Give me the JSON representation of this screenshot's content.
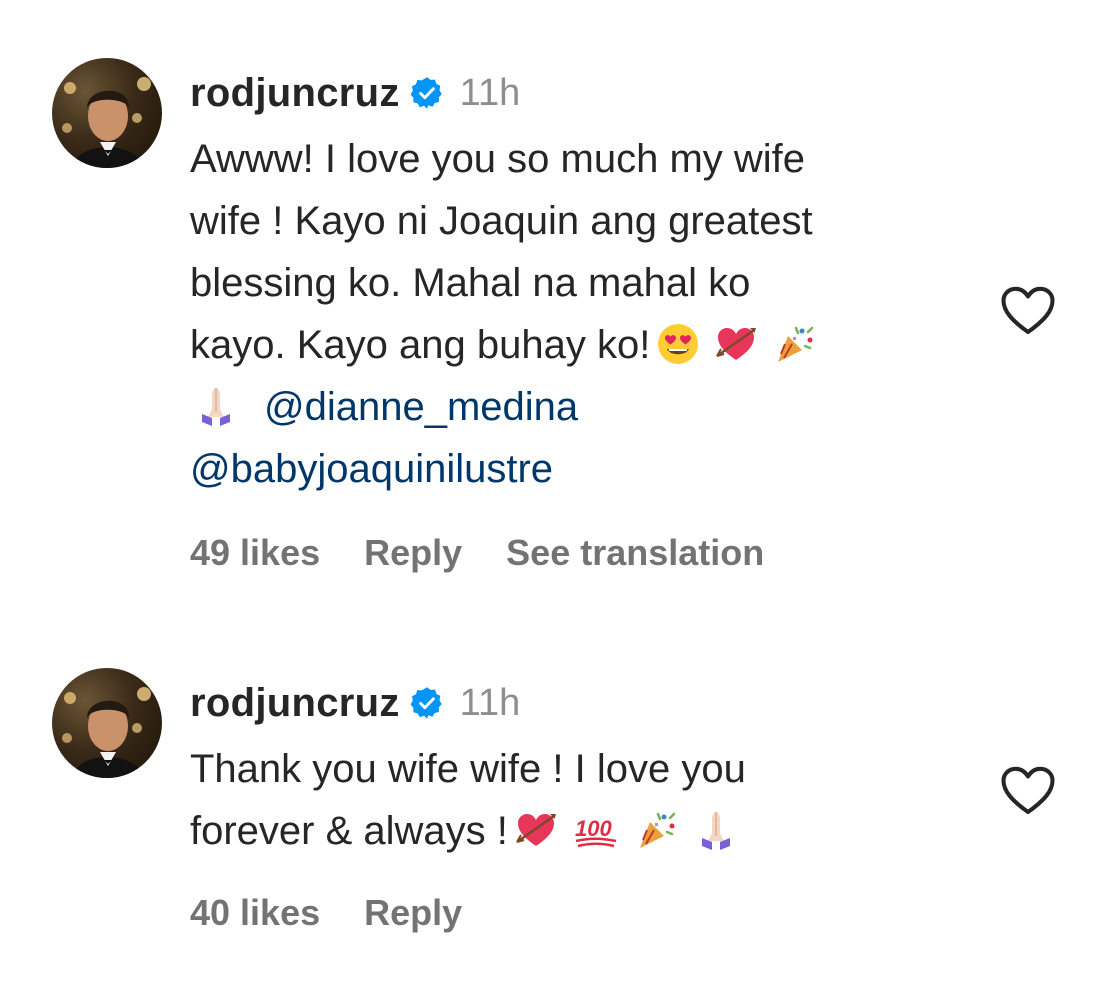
{
  "comments": [
    {
      "username": "rodjuncruz",
      "verified_icon": "verified-badge-icon",
      "time": "11h",
      "lines": [
        {
          "text": "Awww! I love you so much my wife"
        },
        {
          "text": "wife ! Kayo ni Joaquin ang greatest"
        },
        {
          "text": "blessing ko. Mahal na mahal ko"
        },
        {
          "text": "kayo. Kayo ang buhay ko!"
        }
      ],
      "emojis_line4": [
        "heart-eyes-emoji",
        "heart-arrow-emoji",
        "party-popper-emoji"
      ],
      "mention_1": "@dianne_medina",
      "mention_2": "@babyjoaquinilustre",
      "likes": "49 likes",
      "reply": "Reply",
      "translate": "See translation"
    },
    {
      "username": "rodjuncruz",
      "verified_icon": "verified-badge-icon",
      "time": "11h",
      "lines": [
        {
          "text": "Thank you wife wife ! I love you"
        },
        {
          "text": "forever & always !"
        }
      ],
      "emojis_line2": [
        "heart-arrow-emoji",
        "hundred-points-emoji",
        "party-popper-emoji",
        "praying-hands-emoji"
      ],
      "likes": "40 likes",
      "reply": "Reply"
    }
  ],
  "colors": {
    "text": "#262626",
    "muted": "#8e8e8e",
    "mention": "#00376b",
    "verified": "#0095f6"
  }
}
